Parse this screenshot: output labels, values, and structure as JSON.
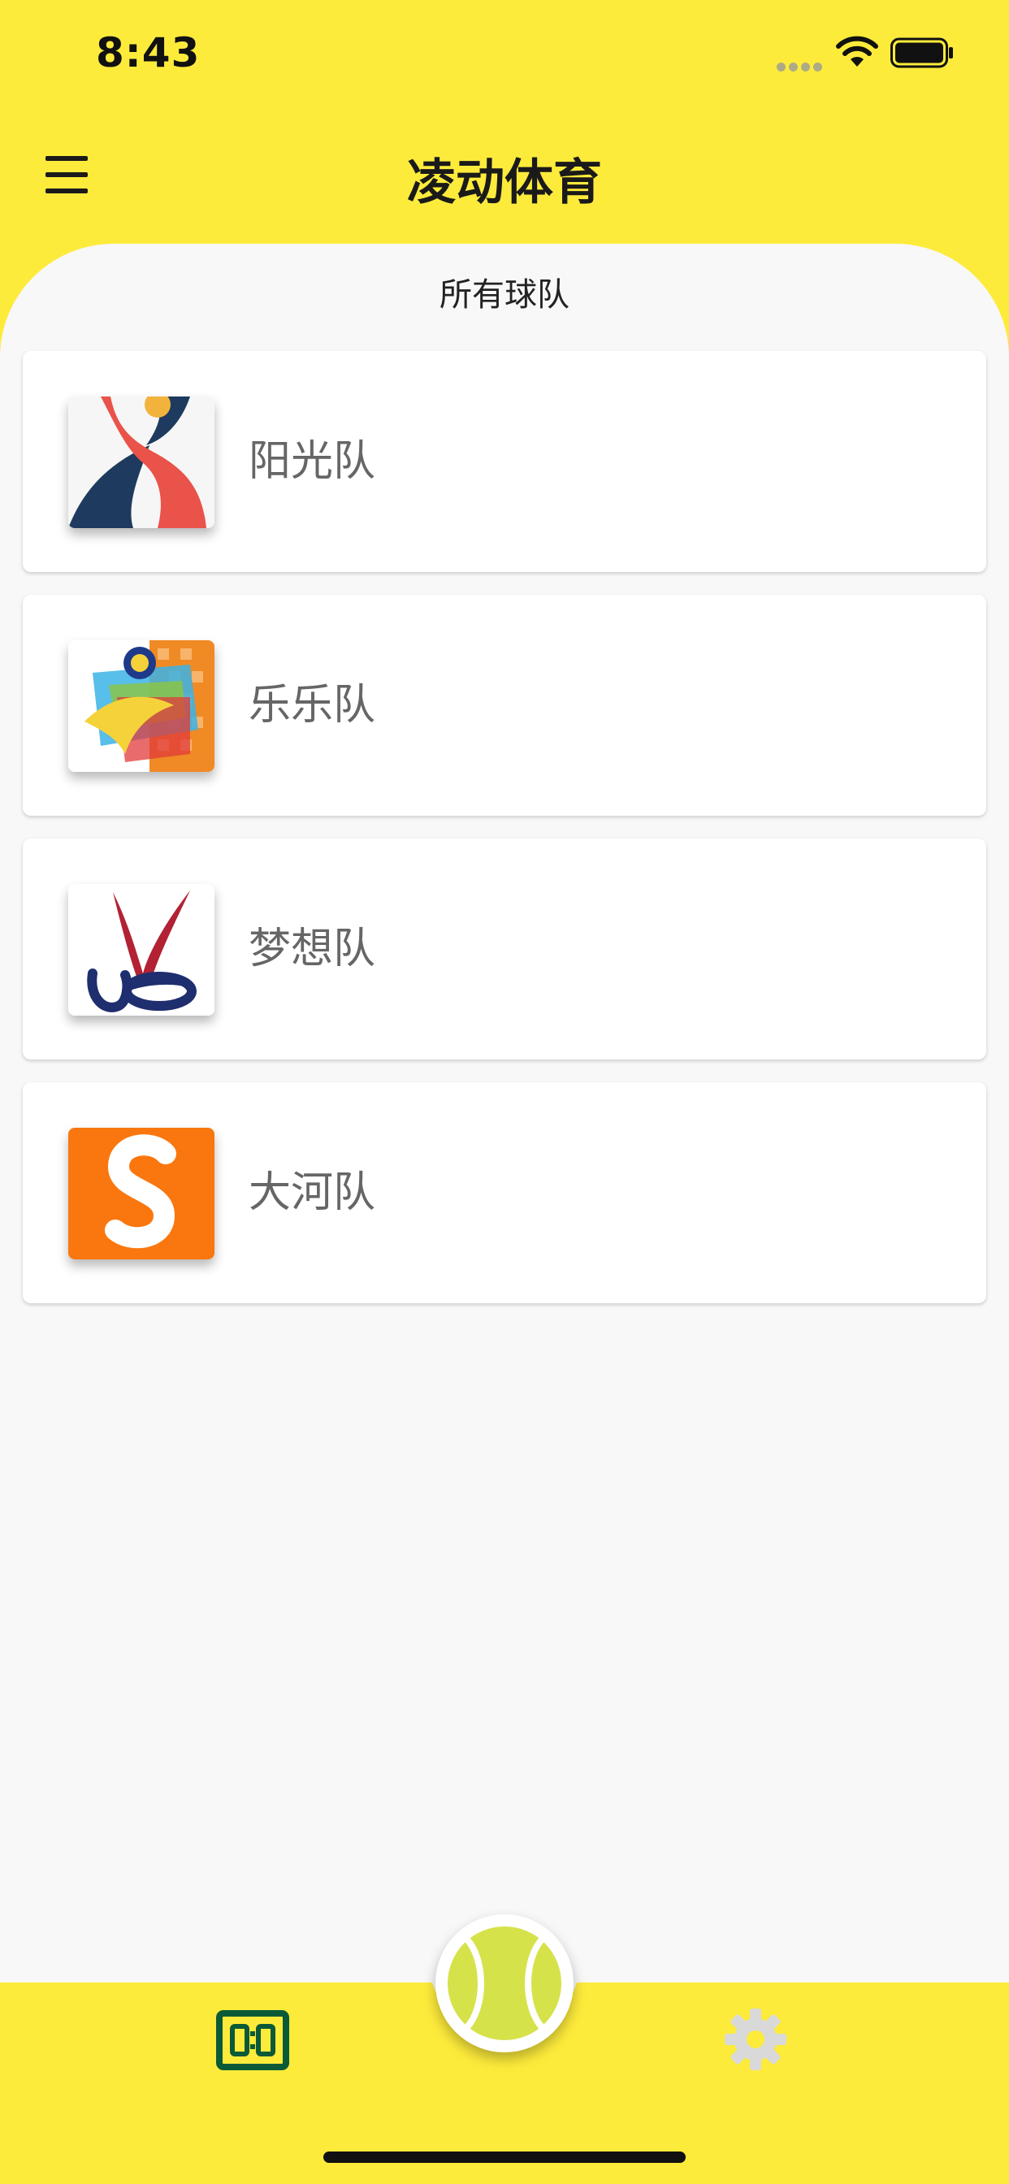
{
  "status_bar": {
    "time": "8:43",
    "icons": [
      "cellular-signal-icon",
      "wifi-icon",
      "battery-icon"
    ]
  },
  "app_bar": {
    "title": "凌动体育",
    "menu_icon": "hamburger-menu-icon"
  },
  "section": {
    "title": "所有球队"
  },
  "teams": [
    {
      "name": "阳光队",
      "logo": "sunshine-team-logo"
    },
    {
      "name": "乐乐队",
      "logo": "lele-team-logo"
    },
    {
      "name": "梦想队",
      "logo": "dream-team-logo"
    },
    {
      "name": "大河队",
      "logo": "river-team-logo"
    }
  ],
  "bottom_nav": {
    "left_icon": "scoreboard-icon",
    "center_icon": "tennis-ball-icon",
    "right_icon": "gear-icon"
  },
  "colors": {
    "accent": "#FDEB3B",
    "sheet_background": "#F8F8F8",
    "scoreboard_icon": "#0B5A37",
    "gear_icon_inactive": "#D9D9D9",
    "tennis_ball": "#D6E24A"
  }
}
